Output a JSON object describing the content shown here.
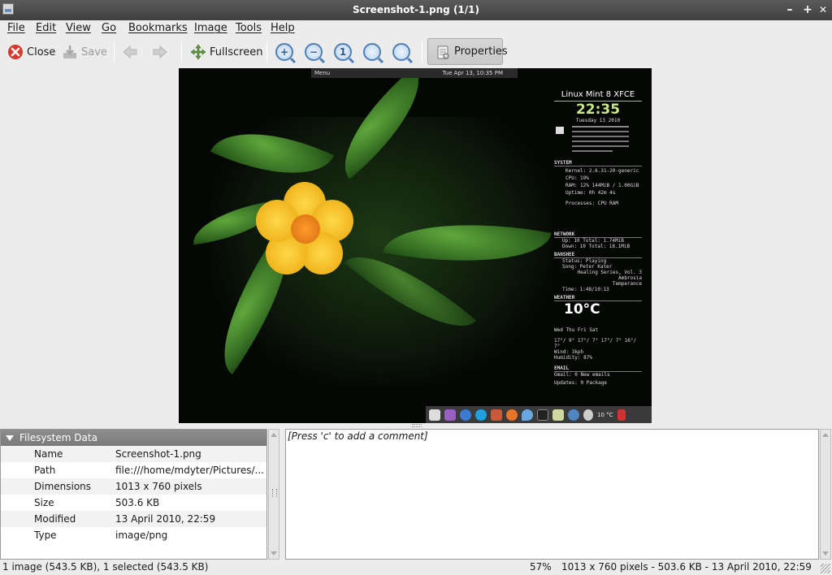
{
  "window": {
    "title": "Screenshot-1.png  (1/1)",
    "minimize_label": "–",
    "maximize_label": "+",
    "close_label": "✕"
  },
  "menu": {
    "file": "File",
    "edit": "Edit",
    "view": "View",
    "go": "Go",
    "bookmarks": "Bookmarks",
    "image": "Image",
    "tools": "Tools",
    "help": "Help"
  },
  "toolbar": {
    "close_label": "Close",
    "save_label": "Save",
    "fullscreen_label": "Fullscreen",
    "properties_label": "Properties",
    "zoom_in_glyph": "+",
    "zoom_out_glyph": "−",
    "zoom_normal_glyph": "1"
  },
  "screenshot": {
    "panel_menu": "Menu",
    "panel_datetime": "Tue Apr 13, 10:35 PM",
    "conky_distro": "Linux Mint 8 XFCE",
    "conky_time": "22:35",
    "conky_date": "Tuesday 13 2010",
    "conky_system": "SYSTEM",
    "conky_kernel": "Kernel:  2.6.31-20-generic",
    "conky_cpu": "CPU: 19%",
    "conky_ram": "RAM: 12%   144MiB / 1.00GiB",
    "conky_uptime": "Uptime:        0h 42m 4s",
    "conky_processes": "Processes:     CPU  RAM",
    "conky_network": "NETWORK",
    "conky_up": "Up: 10   Total: 1.74MiB",
    "conky_down": "Down: 10   Total: 18.1MiB",
    "conky_banshee": "BANSHEE",
    "conky_status": "Status:          Playing",
    "conky_song": "Song:   Peter Kater",
    "conky_song2": "Healing Series, Vol. 3 Ambrosia",
    "conky_song3": "Temperance",
    "conky_songtime": "Time:         1:48/10:13",
    "conky_weather": "WEATHER",
    "conky_temp": "10°C",
    "conky_days": "Wed   Thu   Fri   Sat",
    "conky_temps": "17°/ 9°  17°/ 7°  17°/ 7°  16°/ 7°",
    "conky_wind": "Wind:              3kph",
    "conky_humidity": "Humidity:           87%",
    "conky_email": "EMAIL",
    "conky_gmail": "Gmail:     0 New emails",
    "conky_updates": "Updates:      0 Package",
    "tray_temp": "10 °C"
  },
  "properties": {
    "header": "Filesystem Data",
    "rows": [
      {
        "key": "Name",
        "value": "Screenshot-1.png"
      },
      {
        "key": "Path",
        "value": "file:///home/mdyter/Pictures/..."
      },
      {
        "key": "Dimensions",
        "value": "1013 x 760 pixels"
      },
      {
        "key": "Size",
        "value": "503.6 KB"
      },
      {
        "key": "Modified",
        "value": "13 April 2010, 22:59"
      },
      {
        "key": "Type",
        "value": "image/png"
      }
    ]
  },
  "comment": {
    "placeholder": "[Press 'c' to add a comment]"
  },
  "status": {
    "selection": "1 image (543.5 KB), 1 selected (543.5 KB)",
    "zoom": "57%",
    "info": "1013 x 760 pixels - 503.6 KB - 13 April 2010, 22:59"
  }
}
